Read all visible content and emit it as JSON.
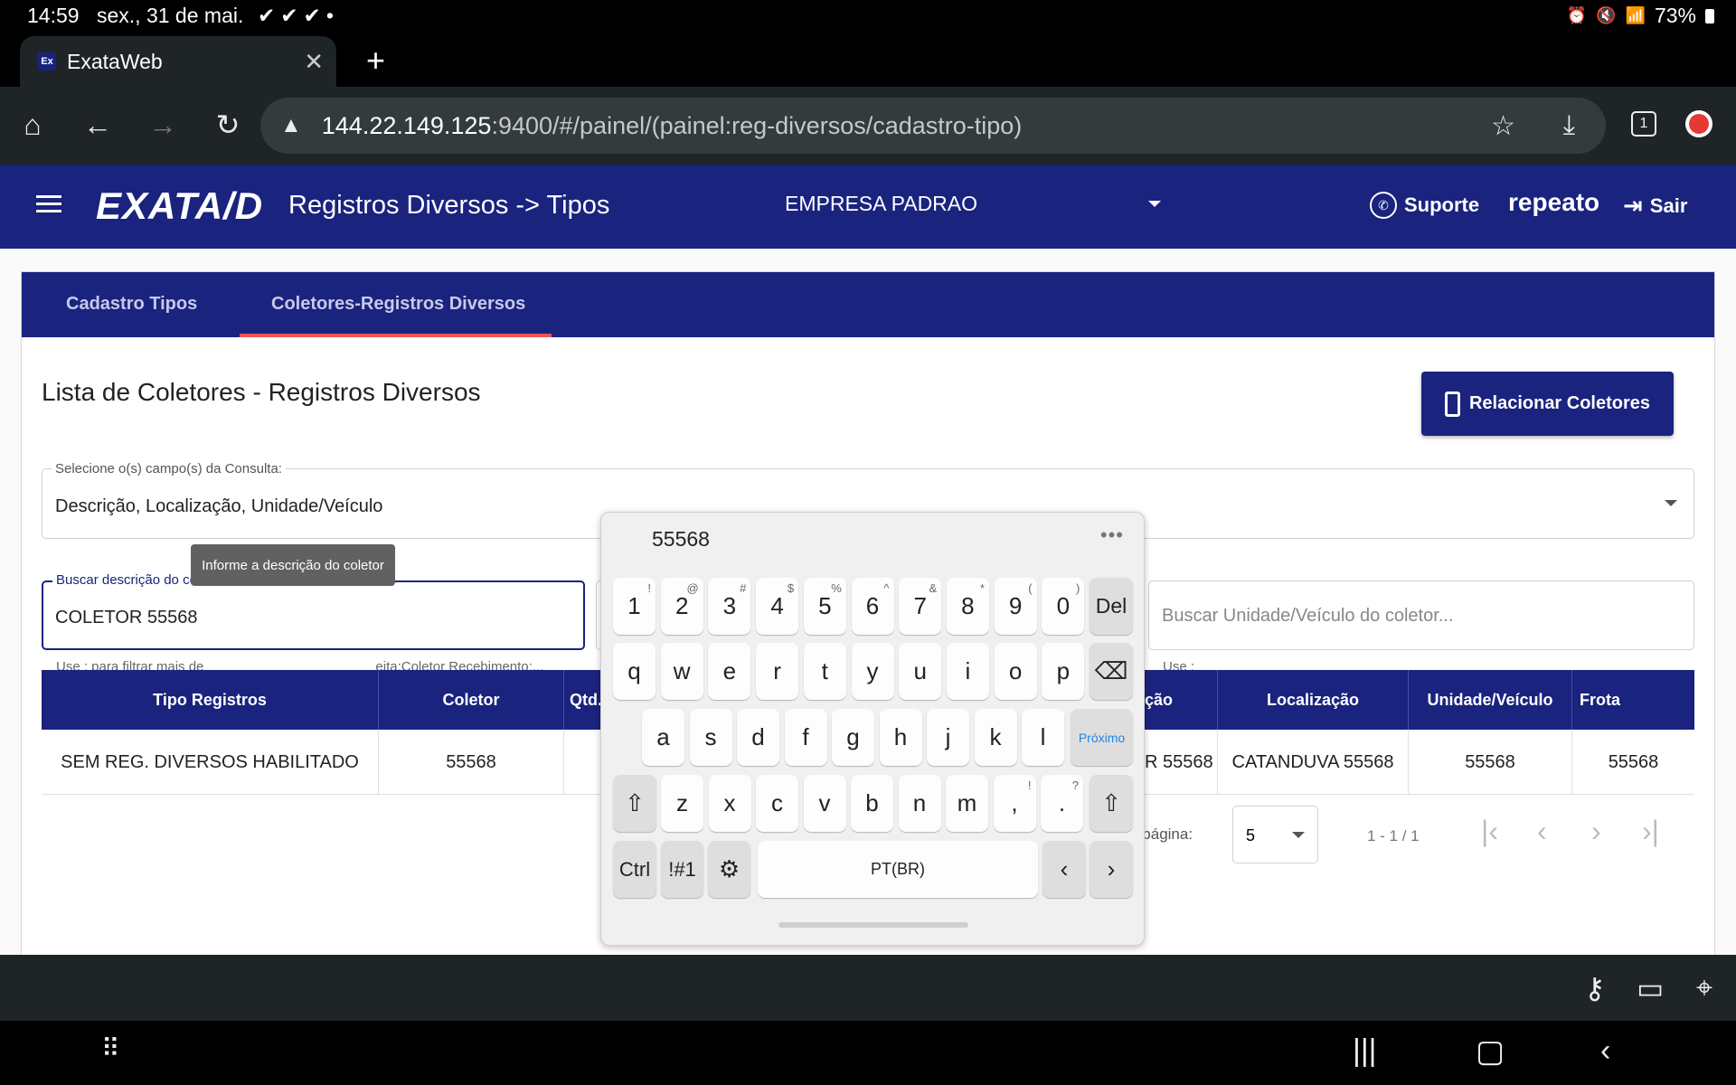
{
  "status_bar": {
    "time": "14:59",
    "date": "sex., 31 de mai.",
    "notification_icons": [
      "check-icon",
      "check-icon",
      "check-icon",
      "dot-icon"
    ],
    "battery": "73%"
  },
  "browser": {
    "tab_title": "ExataWeb",
    "tab_favicon": "Ex",
    "url_host": "144.22.149.125",
    "url_rest": ":9400/#/painel/(painel:reg-diversos/cadastro-tipo)",
    "tab_count": "1"
  },
  "app": {
    "logo": "EXATA/D",
    "title": "Registros Diversos -> Tipos",
    "company": "EMPRESA PADRAO",
    "support_label": "Suporte",
    "user": "repeato",
    "logout_label": "Sair",
    "brand_color": "#1a237e"
  },
  "tabs": [
    {
      "label": "Cadastro Tipos",
      "active": false
    },
    {
      "label": "Coletores-Registros Diversos",
      "active": true
    }
  ],
  "content": {
    "title": "Lista de Coletores - Registros Diversos",
    "relate_button": "Relacionar Coletores",
    "fields_select": {
      "label": "Selecione o(s) campo(s) da Consulta:",
      "value": "Descrição, Localização, Unidade/Veículo"
    },
    "search_description": {
      "label": "Buscar descrição do coletor...",
      "value": "COLETOR 55568",
      "hint": "Use ; para filtrar mais de",
      "hint_tail": "eita;Coletor Recebimento;...",
      "tooltip": "Informe a descrição do coletor"
    },
    "search_unit": {
      "placeholder": "Buscar Unidade/Veículo do coletor...",
      "hint": "Use ;"
    }
  },
  "table": {
    "headers": [
      "Tipo Registros",
      "Coletor",
      "Qtd.",
      "ção",
      "Localização",
      "Unidade/Veículo",
      "Frota"
    ],
    "rows": [
      [
        "SEM REG. DIVERSOS HABILITADO",
        "55568",
        "",
        "R 55568",
        "CATANDUVA 55568",
        "55568",
        "55568"
      ]
    ]
  },
  "pagination": {
    "label": "por página:",
    "page_size": "5",
    "range": "1 - 1 / 1"
  },
  "keyboard": {
    "prediction": "55568",
    "row1": [
      [
        "1",
        "!"
      ],
      [
        "2",
        "@"
      ],
      [
        "3",
        "#"
      ],
      [
        "4",
        "$"
      ],
      [
        "5",
        "%"
      ],
      [
        "6",
        "^"
      ],
      [
        "7",
        "&"
      ],
      [
        "8",
        "*"
      ],
      [
        "9",
        "("
      ],
      [
        "0",
        ")"
      ]
    ],
    "del": "Del",
    "row2": [
      "q",
      "w",
      "e",
      "r",
      "t",
      "y",
      "u",
      "i",
      "o",
      "p"
    ],
    "row3": [
      "a",
      "s",
      "d",
      "f",
      "g",
      "h",
      "j",
      "k",
      "l"
    ],
    "next": "Próximo",
    "row4": [
      [
        "z",
        ""
      ],
      [
        "x",
        ""
      ],
      [
        "c",
        ""
      ],
      [
        "v",
        ""
      ],
      [
        "b",
        ""
      ],
      [
        "n",
        ""
      ],
      [
        "m",
        ""
      ],
      [
        ",",
        "!"
      ],
      [
        ".",
        "?"
      ]
    ],
    "ctrl": "Ctrl",
    "symbols": "!#1",
    "space": "PT(BR)"
  }
}
